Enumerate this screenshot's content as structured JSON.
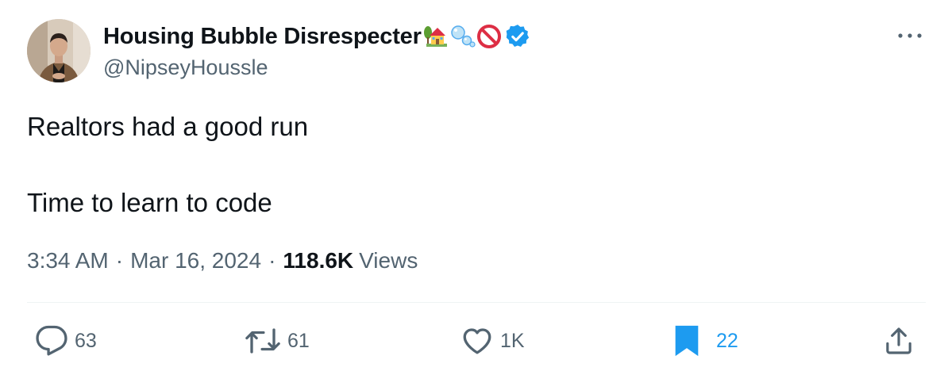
{
  "author": {
    "display_name": "Housing Bubble Disrespecter",
    "name_emojis": [
      "house-with-garden-icon",
      "bubbles-icon",
      "prohibited-icon"
    ],
    "verified": true,
    "handle": "@NipseyHoussle"
  },
  "tweet": {
    "text": "Realtors had a good run\n\nTime to learn to code"
  },
  "meta": {
    "time": "3:34 AM",
    "separator": "·",
    "date": "Mar 16, 2024",
    "views_count": "118.6K",
    "views_label": "Views"
  },
  "actions": {
    "replies": "63",
    "retweets": "61",
    "likes": "1K",
    "bookmarks": "22"
  },
  "colors": {
    "text": "#0f1419",
    "secondary_text": "#536471",
    "accent_blue": "#1d9bf0",
    "divider": "#eff3f4"
  }
}
